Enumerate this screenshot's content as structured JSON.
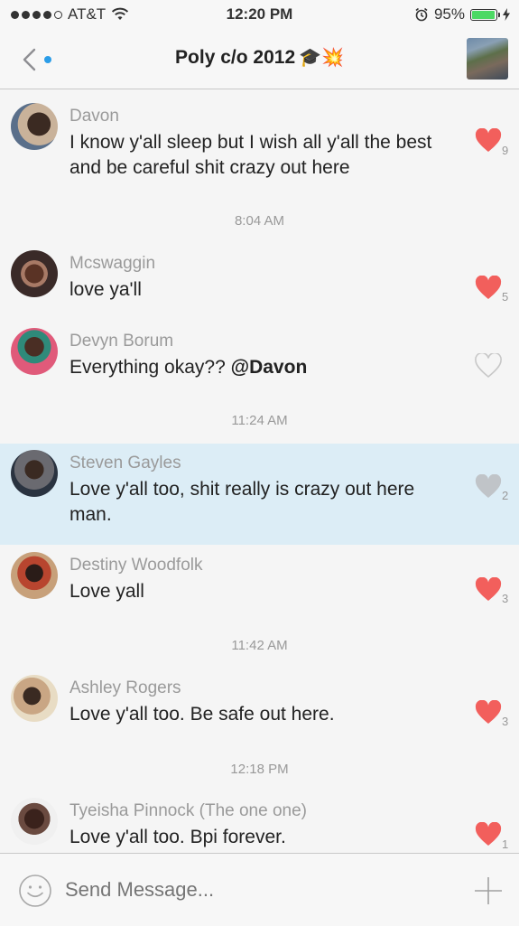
{
  "status_bar": {
    "carrier": "AT&T",
    "time": "12:20 PM",
    "battery": "95%",
    "battery_level": 0.95,
    "signal_bars": 4,
    "signal_total": 5
  },
  "nav": {
    "title": "Poly c/o 2012",
    "title_emoji": "🎓💥"
  },
  "messages": [
    {
      "sender": "Davon",
      "text": "I know y'all sleep  but I wish all y'all the best and be careful shit crazy out here",
      "likes": "9",
      "liked": true
    },
    {
      "sender": "Mcswaggin",
      "text": "love ya'll",
      "likes": "5",
      "liked": true
    },
    {
      "sender": "Devyn Borum",
      "text_prefix": "Everything okay?? ",
      "mention": "@Davon",
      "likes": "",
      "liked": false
    },
    {
      "sender": "Steven Gayles",
      "text": "Love y'all too, shit really is crazy out here man.",
      "likes": "2",
      "liked": false
    },
    {
      "sender": "Destiny Woodfolk",
      "text": "Love yall",
      "likes": "3",
      "liked": true
    },
    {
      "sender": "Ashley Rogers",
      "text": "Love y'all too. Be safe out here.",
      "likes": "3",
      "liked": true
    },
    {
      "sender": "Tyeisha Pinnock (The one one)",
      "text": "Love y'all too. Bpi forever.",
      "likes": "1",
      "liked": true
    }
  ],
  "timestamps": [
    "8:04 AM",
    "11:24 AM",
    "11:42 AM",
    "12:18 PM"
  ],
  "composer": {
    "placeholder": "Send Message..."
  },
  "colors": {
    "heart_liked": "#f25f5c",
    "heart_unliked_outline": "#c8c8c8",
    "heart_unliked_highlight": "#c0c4c8",
    "highlight_row": "#dcedf6",
    "unread_dot": "#2b9de8",
    "battery": "#4cd964"
  }
}
